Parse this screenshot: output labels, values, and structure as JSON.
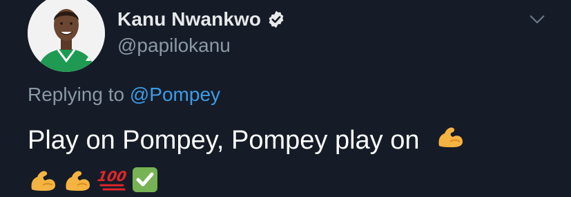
{
  "tweet": {
    "display_name": "Kanu Nwankwo",
    "handle": "@papilokanu",
    "verified": true,
    "replying_prefix": "Replying to",
    "replying_to": "@Pompey",
    "text": "Play on Pompey, Pompey play on",
    "emojis_inline": [
      "flexed-biceps-icon"
    ],
    "emojis_second_line": [
      "flexed-biceps-icon",
      "flexed-biceps-icon",
      "hundred-points-icon",
      "check-mark-button-icon"
    ]
  },
  "colors": {
    "background": "#151c27",
    "name": "#e7e9ea",
    "secondary": "#8b98a5",
    "link": "#3d9be9",
    "emoji_skin": "#f5b342",
    "check_green": "#77b255"
  }
}
